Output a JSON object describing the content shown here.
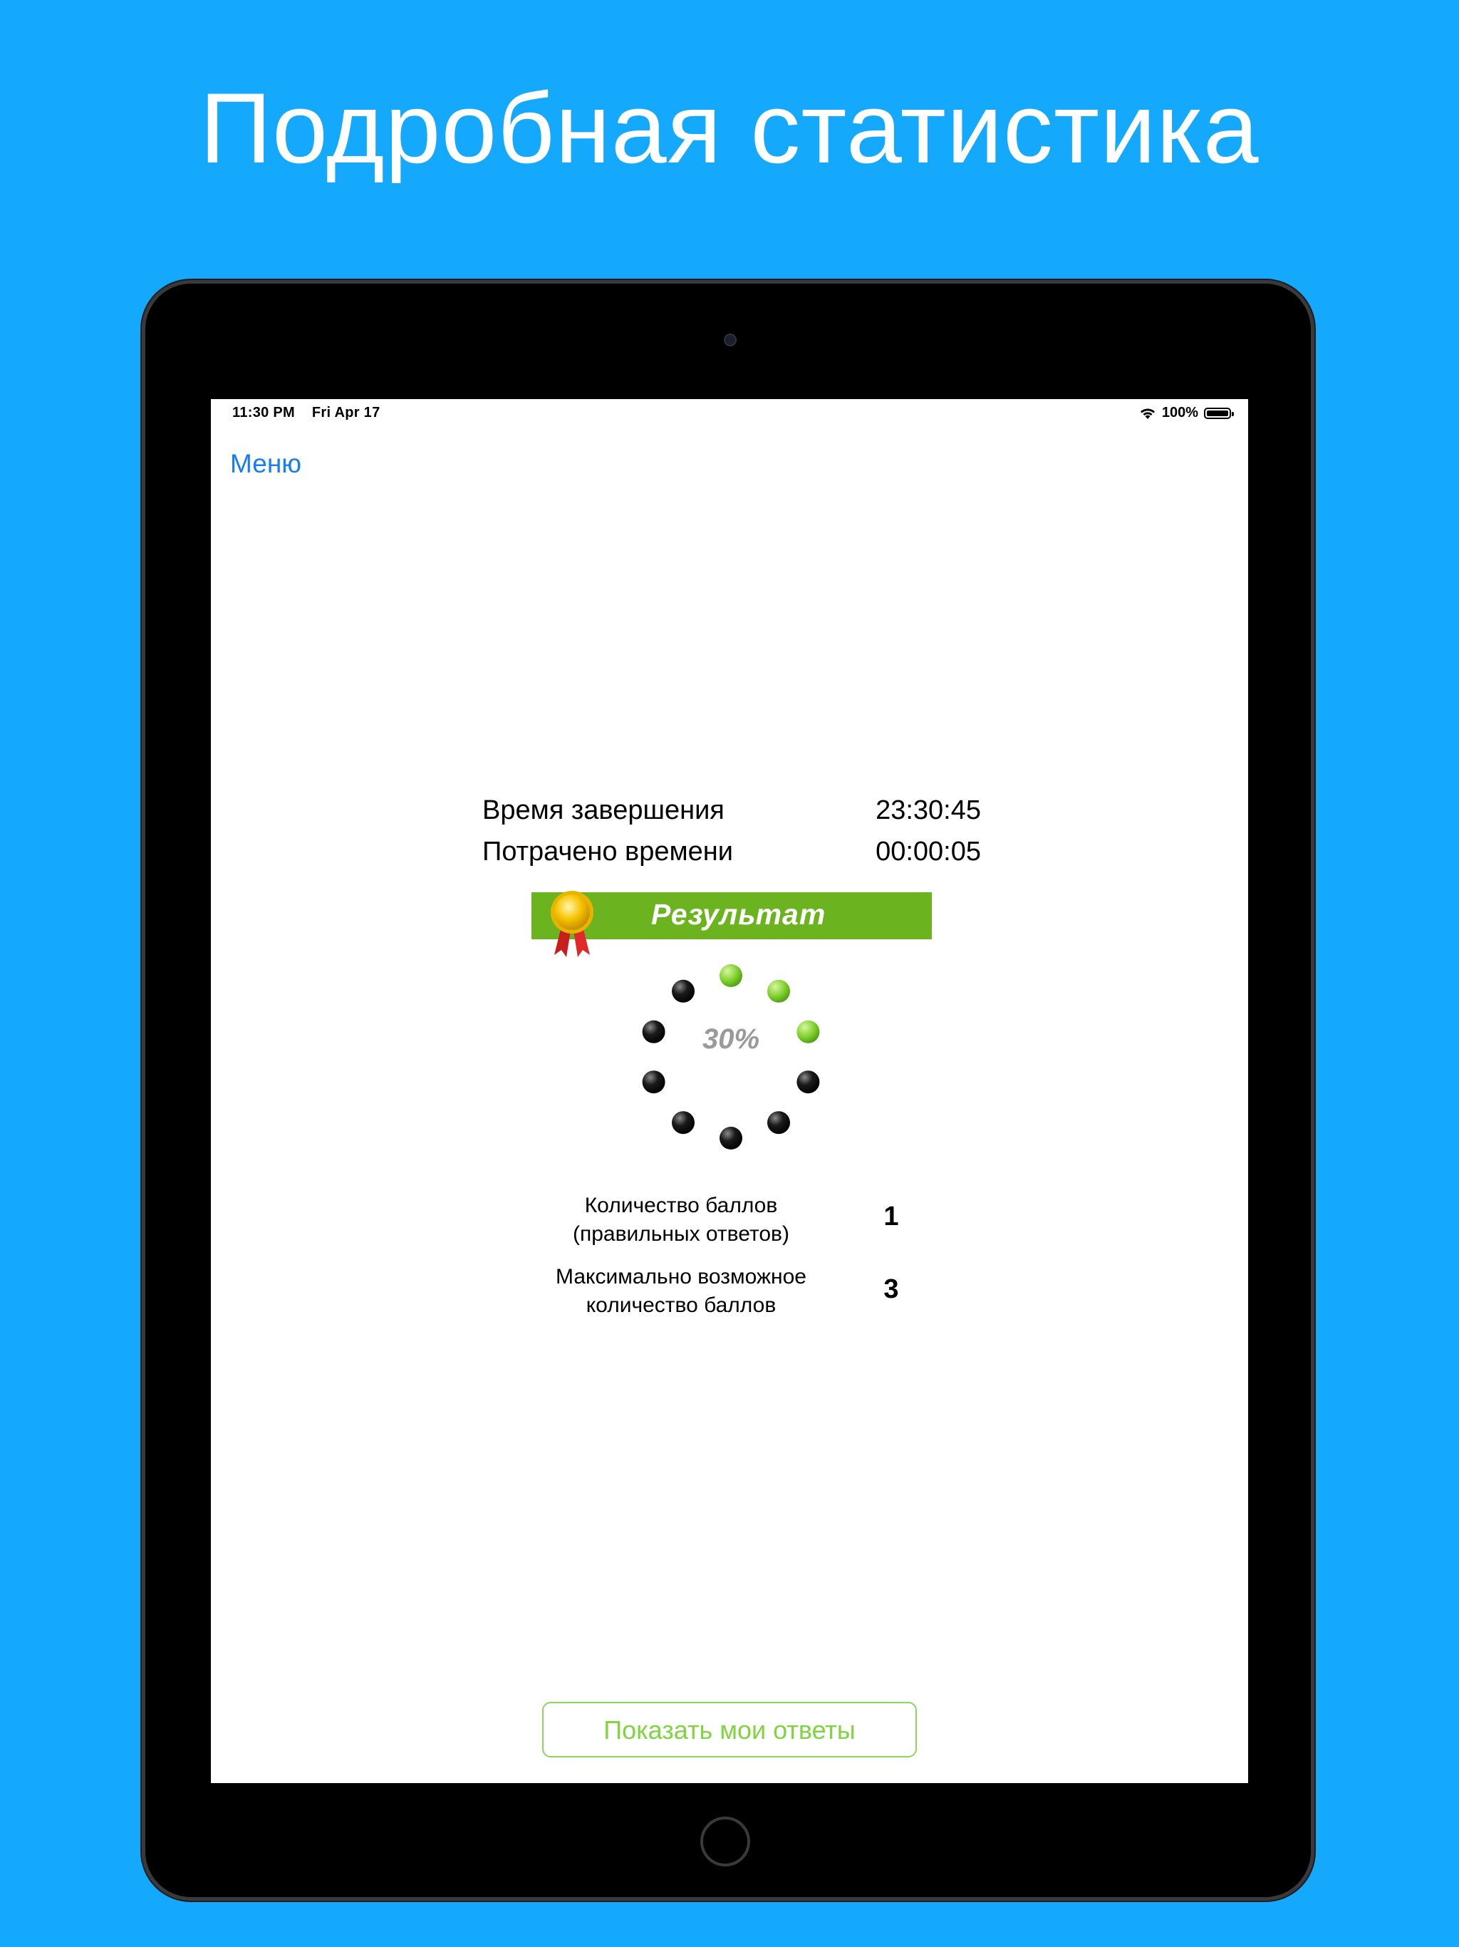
{
  "headline": "Подробная статистика",
  "status_bar": {
    "time": "11:30 PM",
    "date": "Fri Apr 17",
    "battery_percent": "100%",
    "battery_level": 1.0
  },
  "nav": {
    "menu_label": "Меню"
  },
  "timing": {
    "finish_label": "Время завершения",
    "finish_value": "23:30:45",
    "spent_label": "Потрачено времени",
    "spent_value": "00:00:05"
  },
  "result": {
    "title": "Результат",
    "percent_text": "30%",
    "percent": 30,
    "progress_dots": {
      "total": 10,
      "filled": 3
    },
    "colors": {
      "banner": "#6cb41f",
      "filled_dot": "#7ccf2a",
      "empty_dot": "#000000"
    }
  },
  "scores": [
    {
      "label_line1": "Количество баллов",
      "label_line2": "(правильных ответов)",
      "value": "1"
    },
    {
      "label_line1": "Максимально возможное",
      "label_line2": "количество баллов",
      "value": "3"
    }
  ],
  "actions": {
    "show_answers_label": "Показать мои ответы"
  },
  "colors": {
    "background": "#14a9fd",
    "link": "#1a7cf5",
    "button_text": "#7fd43f"
  }
}
